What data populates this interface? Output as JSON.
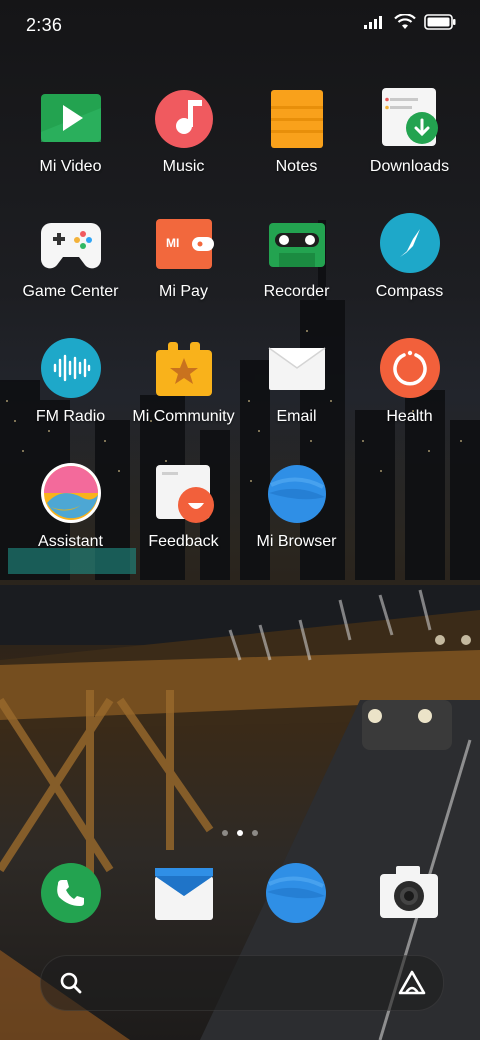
{
  "status_bar": {
    "time": "2:36",
    "icons": [
      "signal-icon",
      "wifi-icon",
      "battery-icon"
    ]
  },
  "apps": [
    {
      "label": "Mi Video",
      "icon": "mi-video-icon"
    },
    {
      "label": "Music",
      "icon": "music-icon"
    },
    {
      "label": "Notes",
      "icon": "notes-icon"
    },
    {
      "label": "Downloads",
      "icon": "downloads-icon"
    },
    {
      "label": "Game Center",
      "icon": "game-center-icon"
    },
    {
      "label": "Mi Pay",
      "icon": "mi-pay-icon"
    },
    {
      "label": "Recorder",
      "icon": "recorder-icon"
    },
    {
      "label": "Compass",
      "icon": "compass-icon"
    },
    {
      "label": "FM Radio",
      "icon": "fm-radio-icon"
    },
    {
      "label": "Mi Community",
      "icon": "mi-community-icon"
    },
    {
      "label": "Email",
      "icon": "email-icon"
    },
    {
      "label": "Health",
      "icon": "health-icon"
    },
    {
      "label": "Assistant",
      "icon": "assistant-icon"
    },
    {
      "label": "Feedback",
      "icon": "feedback-icon"
    },
    {
      "label": "Mi Browser",
      "icon": "mi-browser-icon"
    }
  ],
  "mi_pay_badge": "MI",
  "page_indicator": {
    "pages": 3,
    "active": 2
  },
  "dock": [
    {
      "icon": "phone-icon"
    },
    {
      "icon": "messages-icon"
    },
    {
      "icon": "browser-icon"
    },
    {
      "icon": "camera-icon"
    }
  ],
  "search_bar": {
    "left_icon": "search-icon",
    "right_icon": "assistant-logo-icon"
  }
}
